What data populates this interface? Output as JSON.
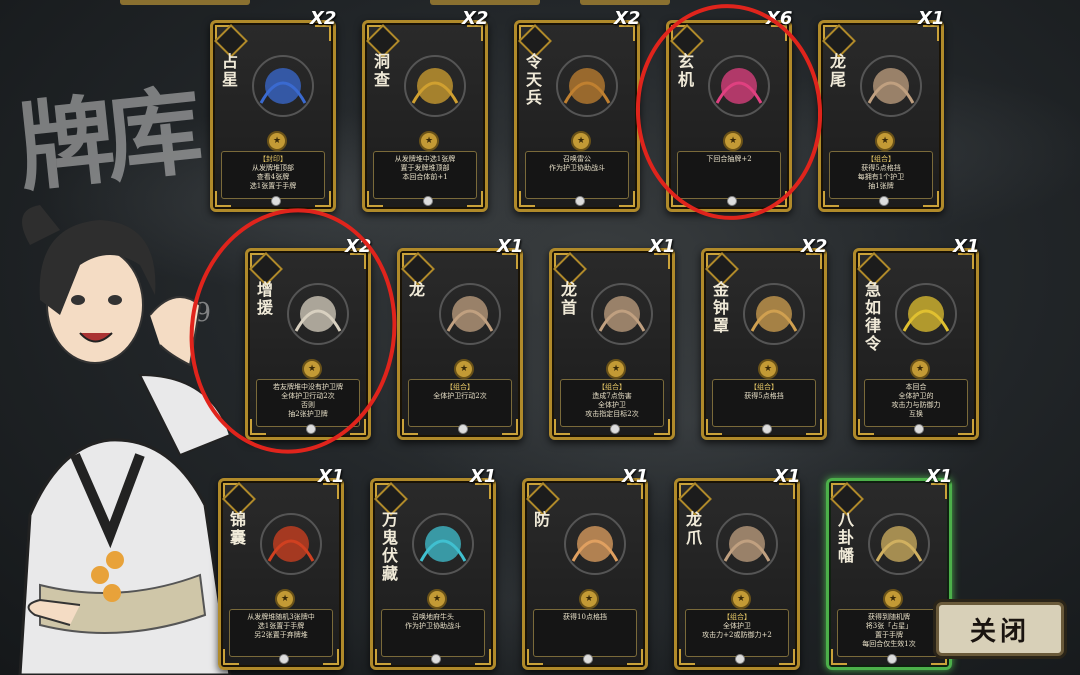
{
  "deck": {
    "title": "牌库",
    "count": "29"
  },
  "cards": [
    {
      "name": "占星",
      "qty": "X2",
      "tag": "【封印】",
      "lines": [
        "从发牌堆顶部",
        "查看4张牌",
        "选1张置于手牌"
      ],
      "art": "constellation-art"
    },
    {
      "name": "洞查",
      "qty": "X2",
      "tag": "",
      "lines": [
        "从发牌堆中选1张牌",
        "置于发牌堆顶部",
        "本回合体前+1"
      ],
      "art": "eye-art"
    },
    {
      "name": "令天兵",
      "qty": "X2",
      "tag": "",
      "lines": [
        "召唤雷公",
        "作为护卫协助战斗"
      ],
      "art": "thunder-god-art"
    },
    {
      "name": "玄机",
      "qty": "X6",
      "tag": "",
      "lines": [
        "下回合抽牌+2"
      ],
      "art": "brush-art"
    },
    {
      "name": "龙尾",
      "qty": "X1",
      "tag": "【组合】",
      "lines": [
        "获得5点格挡",
        "每拥有1个护卫",
        "抽1张牌"
      ],
      "art": "dragon-tail-art"
    },
    {
      "name": "增援",
      "qty": "X2",
      "tag": "",
      "lines": [
        "若友牌堆中没有护卫牌",
        "全体护卫行动2次",
        "否则",
        "抽2张护卫牌"
      ],
      "art": "flags-art"
    },
    {
      "name": "龙",
      "qty": "X1",
      "tag": "【组合】",
      "lines": [
        "全体护卫行动2次"
      ],
      "art": "dragon-body-art"
    },
    {
      "name": "龙首",
      "qty": "X1",
      "tag": "【组合】",
      "lines": [
        "造成7点伤害",
        "全体护卫",
        "攻击指定目标2次"
      ],
      "art": "dragon-head-art"
    },
    {
      "name": "金钟罩",
      "qty": "X2",
      "tag": "【组合】",
      "lines": [
        "获得5点格挡"
      ],
      "art": "bell-art"
    },
    {
      "name": "急如律令",
      "qty": "X1",
      "tag": "",
      "lines": [
        "本回合",
        "全体护卫的",
        "攻击力与防御力",
        "互换"
      ],
      "art": "talisman-art"
    },
    {
      "name": "锦囊",
      "qty": "X1",
      "tag": "",
      "lines": [
        "从发牌堆随机3张牌中",
        "选1张置于手牌",
        "另2张置于弃牌堆"
      ],
      "art": "pouch-art"
    },
    {
      "name": "万鬼伏藏",
      "qty": "X1",
      "tag": "",
      "lines": [
        "召唤地府牛头",
        "作为护卫协助战斗"
      ],
      "art": "ghost-art"
    },
    {
      "name": "防",
      "qty": "X1",
      "tag": "",
      "lines": [
        "获得10点格挡"
      ],
      "art": "shield-art"
    },
    {
      "name": "龙爪",
      "qty": "X1",
      "tag": "【组合】",
      "lines": [
        "全体护卫",
        "攻击力+2或防御力+2"
      ],
      "art": "dragon-claw-art"
    },
    {
      "name": "八卦幡",
      "qty": "X1",
      "tag": "",
      "lines": [
        "获得到随机牌",
        "将3张「占星」",
        "置于手牌",
        "每回合仅生效1次"
      ],
      "art": "bagua-banner-art"
    }
  ],
  "close_button": "关闭",
  "colors": {
    "card_border": "#b08a2a",
    "highlight_card": "#4cb04a",
    "annotation": "#e0241c"
  }
}
